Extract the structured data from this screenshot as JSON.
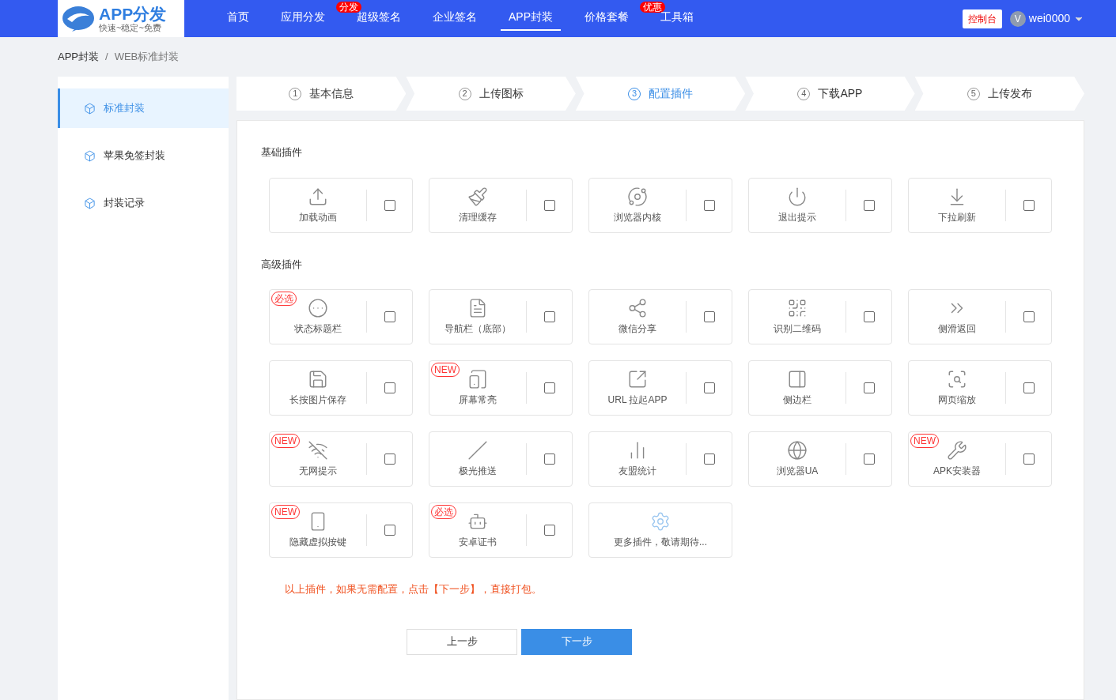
{
  "logo": {
    "title": "APP分发",
    "slogan": "快速~稳定~免费"
  },
  "nav": [
    {
      "label": "首页",
      "selected": false
    },
    {
      "label": "应用分发",
      "selected": false,
      "badge": "分发"
    },
    {
      "label": "超级签名",
      "selected": false
    },
    {
      "label": "企业签名",
      "selected": false
    },
    {
      "label": "APP封装",
      "selected": true
    },
    {
      "label": "价格套餐",
      "selected": false,
      "badge": "优惠"
    },
    {
      "label": "工具箱",
      "selected": false
    }
  ],
  "console_button": "控制台",
  "user": {
    "initial": "V",
    "name": "wei0000"
  },
  "breadcrumb": [
    "APP封装",
    "/",
    "WEB标准封装"
  ],
  "sidebar": [
    {
      "label": "标准封装",
      "selected": true
    },
    {
      "label": "苹果免签封装",
      "selected": false
    },
    {
      "label": "封装记录",
      "selected": false
    }
  ],
  "steps": [
    {
      "number": "1",
      "label": "基本信息",
      "selected": false
    },
    {
      "number": "2",
      "label": "上传图标",
      "selected": false
    },
    {
      "number": "3",
      "label": "配置插件",
      "selected": true
    },
    {
      "number": "4",
      "label": "下载APP",
      "selected": false
    },
    {
      "number": "5",
      "label": "上传发布",
      "selected": false
    }
  ],
  "sections": [
    {
      "title": "基础插件",
      "plugins": [
        {
          "kind": "plugin",
          "label": "加载动画",
          "checked": false
        },
        {
          "kind": "plugin",
          "label": "清理缓存",
          "checked": false
        },
        {
          "kind": "plugin",
          "label": "浏览器内核",
          "checked": false
        },
        {
          "kind": "plugin",
          "label": "退出提示",
          "checked": false
        },
        {
          "kind": "plugin",
          "label": "下拉刷新",
          "checked": false
        }
      ]
    },
    {
      "title": "高级插件",
      "plugins": [
        {
          "kind": "plugin",
          "label": "状态标题栏",
          "checked": false,
          "badge": "必选"
        },
        {
          "kind": "plugin",
          "label": "导航栏（底部）",
          "checked": false
        },
        {
          "kind": "plugin",
          "label": "微信分享",
          "checked": false
        },
        {
          "kind": "plugin",
          "label": "识别二维码",
          "checked": false
        },
        {
          "kind": "plugin",
          "label": "侧滑返回",
          "checked": false
        },
        {
          "kind": "plugin",
          "label": "长按图片保存",
          "checked": false
        },
        {
          "kind": "plugin",
          "label": "屏幕常亮",
          "checked": false,
          "badge": "NEW"
        },
        {
          "kind": "plugin",
          "label": "URL 拉起APP",
          "checked": false
        },
        {
          "kind": "plugin",
          "label": "侧边栏",
          "checked": false
        },
        {
          "kind": "plugin",
          "label": "网页缩放",
          "checked": false
        },
        {
          "kind": "plugin",
          "label": "无网提示",
          "checked": false,
          "badge": "NEW"
        },
        {
          "kind": "plugin",
          "label": "极光推送",
          "checked": false
        },
        {
          "kind": "plugin",
          "label": "友盟统计",
          "checked": false
        },
        {
          "kind": "plugin",
          "label": "浏览器UA",
          "checked": false
        },
        {
          "kind": "plugin",
          "label": "APK安装器",
          "checked": false,
          "badge": "NEW"
        },
        {
          "kind": "plugin",
          "label": "隐藏虚拟按键",
          "checked": false,
          "badge": "NEW"
        },
        {
          "kind": "plugin",
          "label": "安卓证书",
          "checked": false,
          "badge": "必选"
        },
        {
          "kind": "more",
          "label": "更多插件，敬请期待..."
        }
      ]
    }
  ],
  "notice": "以上插件，如果无需配置，点击【下一步】，直接打包。",
  "buttons": [
    {
      "label": "上一步",
      "kind": "secondary"
    },
    {
      "label": "下一步",
      "kind": "primary"
    }
  ]
}
